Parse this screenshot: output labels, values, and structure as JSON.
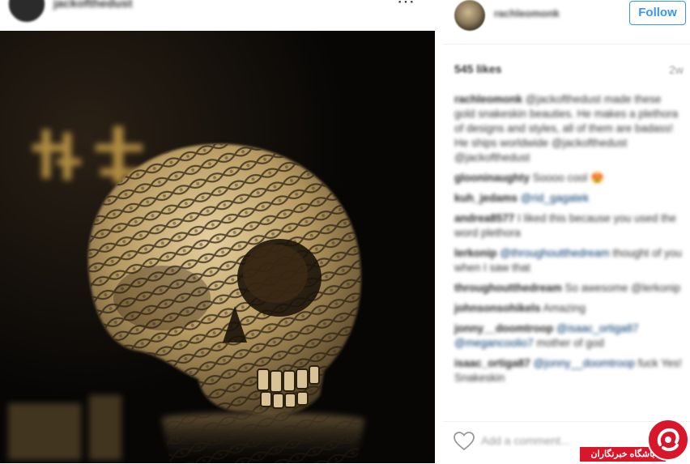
{
  "header": {
    "username": "jackofthedust",
    "more_icon": "three-dots-icon"
  },
  "post": {
    "photo_subject": ""
  },
  "sidebar": {
    "author": "rachleomonk",
    "follow_label": "Follow",
    "likes": "545 likes",
    "age": "2w",
    "comments": [
      {
        "user": "rachleomonk",
        "mention": "",
        "text": "@jackofthedust made these gold snakeskin beauties. He makes a plethora of designs and styles, all of them are badass! He ships worldwide @jackofthedust @jackofthedust"
      },
      {
        "user": "glooninaughty",
        "mention": "",
        "text": "Soooo cool 😍"
      },
      {
        "user": "kuh_jedams",
        "mention": "@rid_gagatek",
        "text": ""
      },
      {
        "user": "andrea8577",
        "mention": "",
        "text": "I liked this because you used the word plethora"
      },
      {
        "user": "lerkonip",
        "mention": "@throughoutthedream",
        "text": "thought of you when I saw that"
      },
      {
        "user": "throughoutthedream",
        "mention": "",
        "text": "So awesome @lerkonip"
      },
      {
        "user": "johnsonsohikels",
        "mention": "",
        "text": "Amazing"
      },
      {
        "user": "jonny__doomtroop",
        "mention": "@isaac_ortiga87 @megancoolio7",
        "text": "mother of god"
      },
      {
        "user": "isaac_ortiga87",
        "mention": "@jonny__doomtroop",
        "text": "fuck Yes! Snakeskin"
      }
    ],
    "add_comment_placeholder": "Add a comment..."
  },
  "watermark": {
    "text": "باشگاه خبرنگاران"
  },
  "colors": {
    "accent": "#3897f0",
    "watermark_red": "#d8182a",
    "photo_bg": "#0d0b09"
  }
}
